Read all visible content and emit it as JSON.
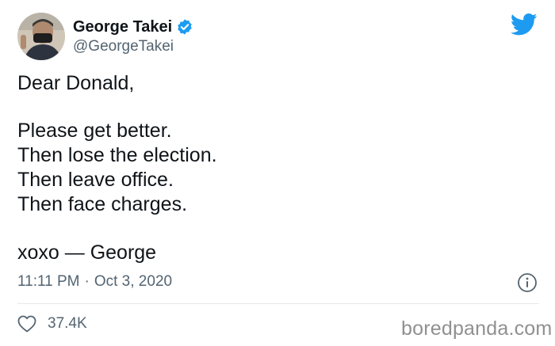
{
  "author": {
    "display_name": "George Takei",
    "handle": "@GeorgeTakei"
  },
  "tweet": {
    "lines": [
      "Dear Donald,",
      "Please get better.",
      "Then lose the election.",
      "Then leave office.",
      "Then face charges.",
      "xoxo — George"
    ]
  },
  "meta": {
    "time": "11:11 PM",
    "separator": "·",
    "date": "Oct 3, 2020"
  },
  "engagement": {
    "likes": "37.4K"
  },
  "watermark": "boredpanda.com",
  "colors": {
    "twitter_blue": "#1d9bf0",
    "secondary_text": "#536471"
  },
  "icons": [
    "verified-badge-icon",
    "twitter-bird-icon",
    "info-icon",
    "heart-icon"
  ]
}
